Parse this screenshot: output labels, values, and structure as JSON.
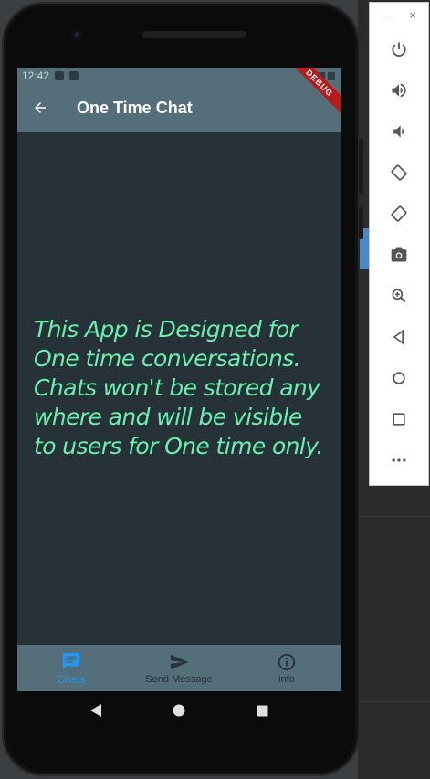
{
  "status_bar": {
    "time": "12:42"
  },
  "debug_banner": "DEBUG",
  "app_bar": {
    "title": "One Time Chat"
  },
  "main": {
    "message": "This App is Designed for One time conversations. Chats won't be stored any where and will be visible to users for One time only."
  },
  "bottom_nav": {
    "items": [
      {
        "label": "Chats",
        "icon": "chat-icon",
        "active": true
      },
      {
        "label": "Send Message",
        "icon": "send-icon",
        "active": false
      },
      {
        "label": "info",
        "icon": "info-icon",
        "active": false
      }
    ]
  },
  "colors": {
    "appbar": "#546e7a",
    "background": "#263238",
    "message_text": "#69f0ae",
    "active_tab": "#2196f3"
  },
  "emulator_toolbar": {
    "window_controls": [
      "–",
      "×"
    ],
    "tools": [
      "power-icon",
      "volume-up-icon",
      "volume-down-icon",
      "rotate-left-icon",
      "rotate-right-icon",
      "camera-icon",
      "zoom-icon",
      "back-icon",
      "home-icon",
      "overview-icon",
      "more-icon"
    ]
  }
}
